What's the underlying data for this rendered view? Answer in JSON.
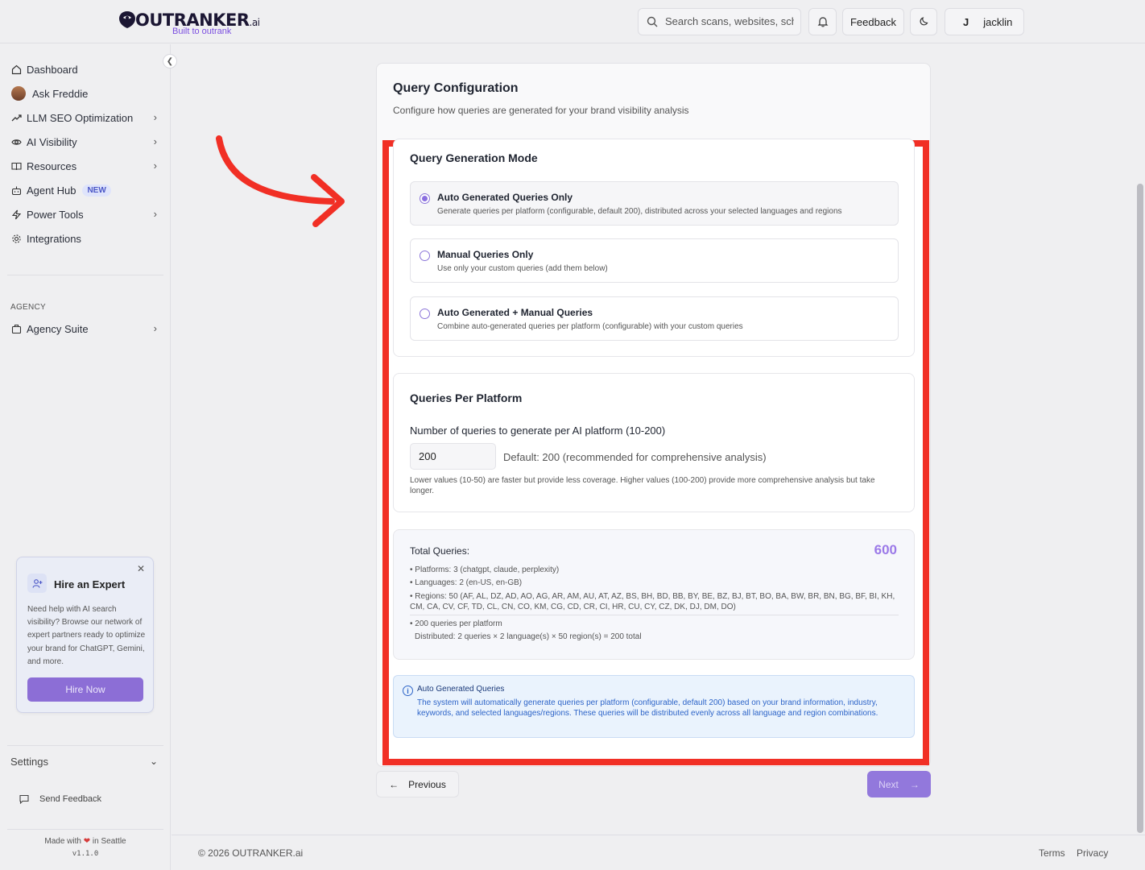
{
  "header": {
    "logo_text": "OUTRANKER",
    "logo_suffix": ".ai",
    "logo_tagline": "Built to outrank",
    "search_placeholder": "Search scans, websites, schemas...",
    "feedback_label": "Feedback",
    "user_initial": "J",
    "user_name": "jacklin"
  },
  "sidebar": {
    "items": [
      {
        "label": "Dashboard",
        "icon": "home-icon"
      },
      {
        "label": "Ask Freddie",
        "icon": "avatar"
      },
      {
        "label": "LLM SEO Optimization",
        "icon": "trending-up-icon",
        "chevron": true
      },
      {
        "label": "AI Visibility",
        "icon": "eye-icon",
        "chevron": true
      },
      {
        "label": "Resources",
        "icon": "book-open-icon",
        "chevron": true
      },
      {
        "label": "Agent Hub",
        "icon": "robot-icon",
        "badge": "NEW"
      },
      {
        "label": "Power Tools",
        "icon": "zap-icon",
        "chevron": true
      },
      {
        "label": "Integrations",
        "icon": "gear-icon"
      }
    ],
    "agency_heading": "AGENCY",
    "agency_item": "Agency Suite",
    "expert": {
      "title": "Hire an Expert",
      "text": "Need help with AI search visibility? Browse our network of expert partners ready to optimize your brand for ChatGPT, Gemini, and more.",
      "button": "Hire Now"
    },
    "settings_label": "Settings",
    "send_feedback": "Send Feedback",
    "made_with_prefix": "Made with",
    "made_with_suffix": "in Seattle",
    "version": "v1.1.0"
  },
  "main": {
    "title": "Query Configuration",
    "subtitle": "Configure how queries are generated for your brand visibility analysis",
    "mode": {
      "title": "Query Generation Mode",
      "options": [
        {
          "title": "Auto Generated Queries Only",
          "desc": "Generate queries per platform (configurable, default 200), distributed across your selected languages and regions",
          "selected": true
        },
        {
          "title": "Manual Queries Only",
          "desc": "Use only your custom queries (add them below)",
          "selected": false
        },
        {
          "title": "Auto Generated + Manual Queries",
          "desc": "Combine auto-generated queries per platform (configurable) with your custom queries",
          "selected": false
        }
      ]
    },
    "per_platform": {
      "title": "Queries Per Platform",
      "label": "Number of queries to generate per AI platform (10-200)",
      "value": "200",
      "default_text": "Default: 200 (recommended for comprehensive analysis)",
      "help": "Lower values (10-50) are faster but provide less coverage. Higher values (100-200) provide more comprehensive analysis but take longer."
    },
    "totals": {
      "label": "Total Queries:",
      "value": "600",
      "platforms": "• Platforms: 3 (chatgpt, claude, perplexity)",
      "languages": "• Languages: 2 (en-US, en-GB)",
      "regions": "• Regions: 50 (AF, AL, DZ, AD, AO, AG, AR, AM, AU, AT, AZ, BS, BH, BD, BB, BY, BE, BZ, BJ, BT, BO, BA, BW, BR, BN, BG, BF, BI, KH, CM, CA, CV, CF, TD, CL, CN, CO, KM, CG, CD, CR, CI, HR, CU, CY, CZ, DK, DJ, DM, DO)",
      "per_platform": "• 200 queries per platform",
      "distributed": "Distributed: 2 queries × 2 language(s) × 50 region(s) = 200 total"
    },
    "info": {
      "title": "Auto Generated Queries",
      "text": "The system will automatically generate queries per platform (configurable, default 200) based on your brand information, industry, keywords, and selected languages/regions. These queries will be distributed evenly across all language and region combinations."
    },
    "prev_label": "Previous",
    "next_label": "Next"
  },
  "footer": {
    "copyright": "© 2026 OUTRANKER.ai",
    "terms": "Terms",
    "privacy": "Privacy"
  },
  "colors": {
    "accent": "#8b6fe0",
    "highlight": "#f12f25",
    "info": "#2d64c8"
  }
}
